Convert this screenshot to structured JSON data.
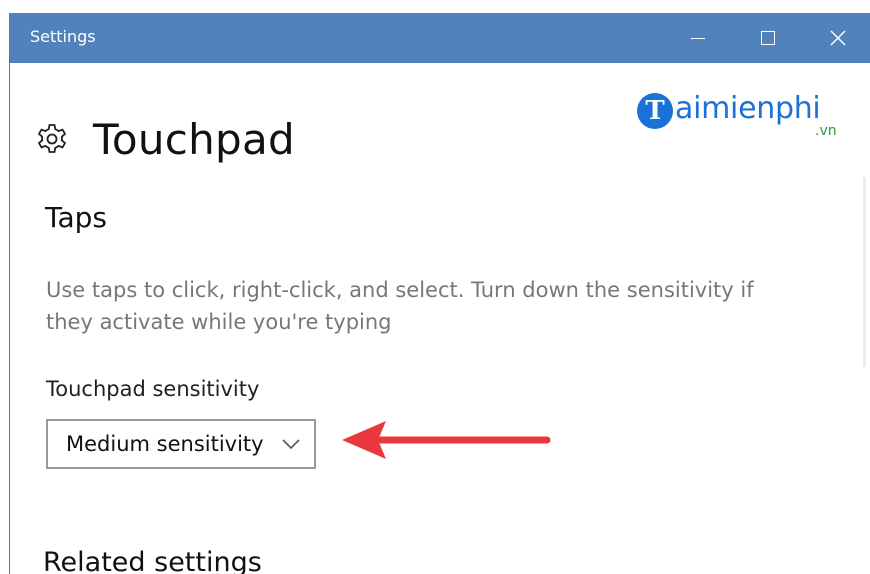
{
  "window": {
    "title": "Settings",
    "titlebar_color": "#5182bb",
    "controls": {
      "minimize_icon": "minimize-icon",
      "maximize_icon": "maximize-icon",
      "close_icon": "close-icon"
    }
  },
  "header": {
    "icon": "gear-icon",
    "title": "Touchpad"
  },
  "watermark": {
    "logo_letter": "T",
    "logo_word": "aimienphi",
    "logo_suffix": ".vn",
    "brand_color": "#1a72d9",
    "suffix_color": "#23a23a"
  },
  "taps": {
    "title": "Taps",
    "description": "Use taps to click, right-click, and select. Turn down the sensitivity if they activate while you're typing",
    "sensitivity_label": "Touchpad sensitivity",
    "sensitivity_value": "Medium sensitivity"
  },
  "annotation": {
    "arrow_color": "#e8383d"
  },
  "related": {
    "title": "Related settings"
  }
}
